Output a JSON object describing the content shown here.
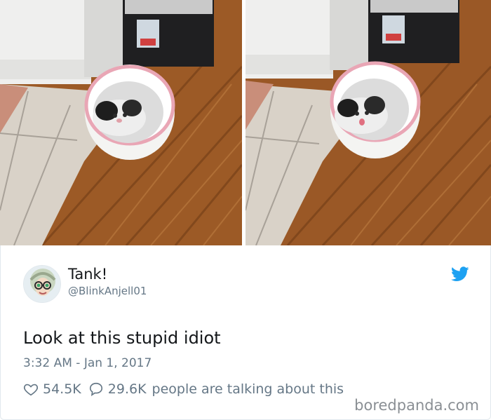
{
  "tweet": {
    "display_name": "Tank!",
    "handle": "@BlinkAnjell01",
    "text": "Look at this stupid idiot",
    "timestamp": "3:32 AM - Jan 1, 2017",
    "likes": "54.5K",
    "replies": "29.6K",
    "talking_text": "people are talking about this"
  },
  "icons": {
    "twitter": "twitter-bird-icon",
    "heart": "heart-icon",
    "reply": "speech-bubble-icon"
  },
  "colors": {
    "twitter_blue": "#1da1f2",
    "muted_text": "#657786"
  },
  "watermark": "boredpanda.com"
}
